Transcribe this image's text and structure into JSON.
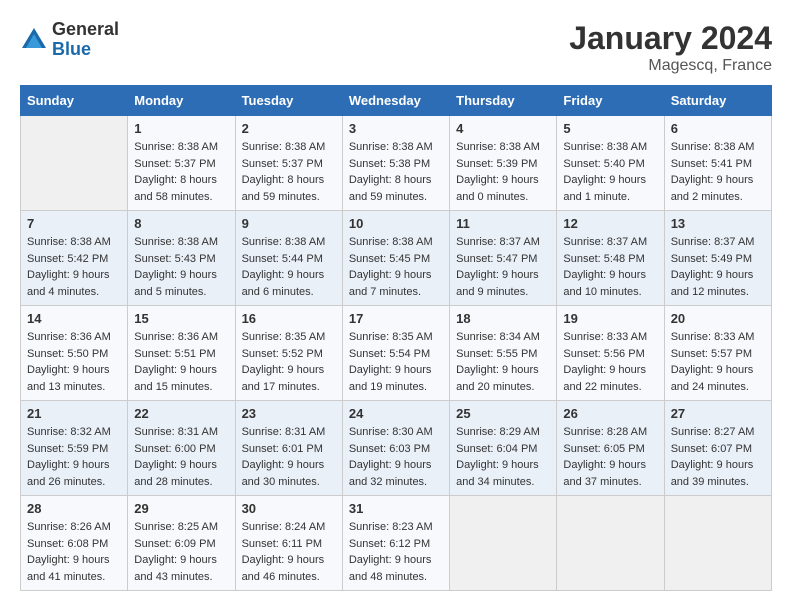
{
  "header": {
    "logo": {
      "general": "General",
      "blue": "Blue"
    },
    "title": "January 2024",
    "location": "Magescq, France"
  },
  "columns": [
    "Sunday",
    "Monday",
    "Tuesday",
    "Wednesday",
    "Thursday",
    "Friday",
    "Saturday"
  ],
  "weeks": [
    [
      {
        "day": "",
        "sunrise": "",
        "sunset": "",
        "daylight": ""
      },
      {
        "day": "1",
        "sunrise": "Sunrise: 8:38 AM",
        "sunset": "Sunset: 5:37 PM",
        "daylight": "Daylight: 8 hours and 58 minutes."
      },
      {
        "day": "2",
        "sunrise": "Sunrise: 8:38 AM",
        "sunset": "Sunset: 5:37 PM",
        "daylight": "Daylight: 8 hours and 59 minutes."
      },
      {
        "day": "3",
        "sunrise": "Sunrise: 8:38 AM",
        "sunset": "Sunset: 5:38 PM",
        "daylight": "Daylight: 8 hours and 59 minutes."
      },
      {
        "day": "4",
        "sunrise": "Sunrise: 8:38 AM",
        "sunset": "Sunset: 5:39 PM",
        "daylight": "Daylight: 9 hours and 0 minutes."
      },
      {
        "day": "5",
        "sunrise": "Sunrise: 8:38 AM",
        "sunset": "Sunset: 5:40 PM",
        "daylight": "Daylight: 9 hours and 1 minute."
      },
      {
        "day": "6",
        "sunrise": "Sunrise: 8:38 AM",
        "sunset": "Sunset: 5:41 PM",
        "daylight": "Daylight: 9 hours and 2 minutes."
      }
    ],
    [
      {
        "day": "7",
        "sunrise": "Sunrise: 8:38 AM",
        "sunset": "Sunset: 5:42 PM",
        "daylight": "Daylight: 9 hours and 4 minutes."
      },
      {
        "day": "8",
        "sunrise": "Sunrise: 8:38 AM",
        "sunset": "Sunset: 5:43 PM",
        "daylight": "Daylight: 9 hours and 5 minutes."
      },
      {
        "day": "9",
        "sunrise": "Sunrise: 8:38 AM",
        "sunset": "Sunset: 5:44 PM",
        "daylight": "Daylight: 9 hours and 6 minutes."
      },
      {
        "day": "10",
        "sunrise": "Sunrise: 8:38 AM",
        "sunset": "Sunset: 5:45 PM",
        "daylight": "Daylight: 9 hours and 7 minutes."
      },
      {
        "day": "11",
        "sunrise": "Sunrise: 8:37 AM",
        "sunset": "Sunset: 5:47 PM",
        "daylight": "Daylight: 9 hours and 9 minutes."
      },
      {
        "day": "12",
        "sunrise": "Sunrise: 8:37 AM",
        "sunset": "Sunset: 5:48 PM",
        "daylight": "Daylight: 9 hours and 10 minutes."
      },
      {
        "day": "13",
        "sunrise": "Sunrise: 8:37 AM",
        "sunset": "Sunset: 5:49 PM",
        "daylight": "Daylight: 9 hours and 12 minutes."
      }
    ],
    [
      {
        "day": "14",
        "sunrise": "Sunrise: 8:36 AM",
        "sunset": "Sunset: 5:50 PM",
        "daylight": "Daylight: 9 hours and 13 minutes."
      },
      {
        "day": "15",
        "sunrise": "Sunrise: 8:36 AM",
        "sunset": "Sunset: 5:51 PM",
        "daylight": "Daylight: 9 hours and 15 minutes."
      },
      {
        "day": "16",
        "sunrise": "Sunrise: 8:35 AM",
        "sunset": "Sunset: 5:52 PM",
        "daylight": "Daylight: 9 hours and 17 minutes."
      },
      {
        "day": "17",
        "sunrise": "Sunrise: 8:35 AM",
        "sunset": "Sunset: 5:54 PM",
        "daylight": "Daylight: 9 hours and 19 minutes."
      },
      {
        "day": "18",
        "sunrise": "Sunrise: 8:34 AM",
        "sunset": "Sunset: 5:55 PM",
        "daylight": "Daylight: 9 hours and 20 minutes."
      },
      {
        "day": "19",
        "sunrise": "Sunrise: 8:33 AM",
        "sunset": "Sunset: 5:56 PM",
        "daylight": "Daylight: 9 hours and 22 minutes."
      },
      {
        "day": "20",
        "sunrise": "Sunrise: 8:33 AM",
        "sunset": "Sunset: 5:57 PM",
        "daylight": "Daylight: 9 hours and 24 minutes."
      }
    ],
    [
      {
        "day": "21",
        "sunrise": "Sunrise: 8:32 AM",
        "sunset": "Sunset: 5:59 PM",
        "daylight": "Daylight: 9 hours and 26 minutes."
      },
      {
        "day": "22",
        "sunrise": "Sunrise: 8:31 AM",
        "sunset": "Sunset: 6:00 PM",
        "daylight": "Daylight: 9 hours and 28 minutes."
      },
      {
        "day": "23",
        "sunrise": "Sunrise: 8:31 AM",
        "sunset": "Sunset: 6:01 PM",
        "daylight": "Daylight: 9 hours and 30 minutes."
      },
      {
        "day": "24",
        "sunrise": "Sunrise: 8:30 AM",
        "sunset": "Sunset: 6:03 PM",
        "daylight": "Daylight: 9 hours and 32 minutes."
      },
      {
        "day": "25",
        "sunrise": "Sunrise: 8:29 AM",
        "sunset": "Sunset: 6:04 PM",
        "daylight": "Daylight: 9 hours and 34 minutes."
      },
      {
        "day": "26",
        "sunrise": "Sunrise: 8:28 AM",
        "sunset": "Sunset: 6:05 PM",
        "daylight": "Daylight: 9 hours and 37 minutes."
      },
      {
        "day": "27",
        "sunrise": "Sunrise: 8:27 AM",
        "sunset": "Sunset: 6:07 PM",
        "daylight": "Daylight: 9 hours and 39 minutes."
      }
    ],
    [
      {
        "day": "28",
        "sunrise": "Sunrise: 8:26 AM",
        "sunset": "Sunset: 6:08 PM",
        "daylight": "Daylight: 9 hours and 41 minutes."
      },
      {
        "day": "29",
        "sunrise": "Sunrise: 8:25 AM",
        "sunset": "Sunset: 6:09 PM",
        "daylight": "Daylight: 9 hours and 43 minutes."
      },
      {
        "day": "30",
        "sunrise": "Sunrise: 8:24 AM",
        "sunset": "Sunset: 6:11 PM",
        "daylight": "Daylight: 9 hours and 46 minutes."
      },
      {
        "day": "31",
        "sunrise": "Sunrise: 8:23 AM",
        "sunset": "Sunset: 6:12 PM",
        "daylight": "Daylight: 9 hours and 48 minutes."
      },
      {
        "day": "",
        "sunrise": "",
        "sunset": "",
        "daylight": ""
      },
      {
        "day": "",
        "sunrise": "",
        "sunset": "",
        "daylight": ""
      },
      {
        "day": "",
        "sunrise": "",
        "sunset": "",
        "daylight": ""
      }
    ]
  ]
}
